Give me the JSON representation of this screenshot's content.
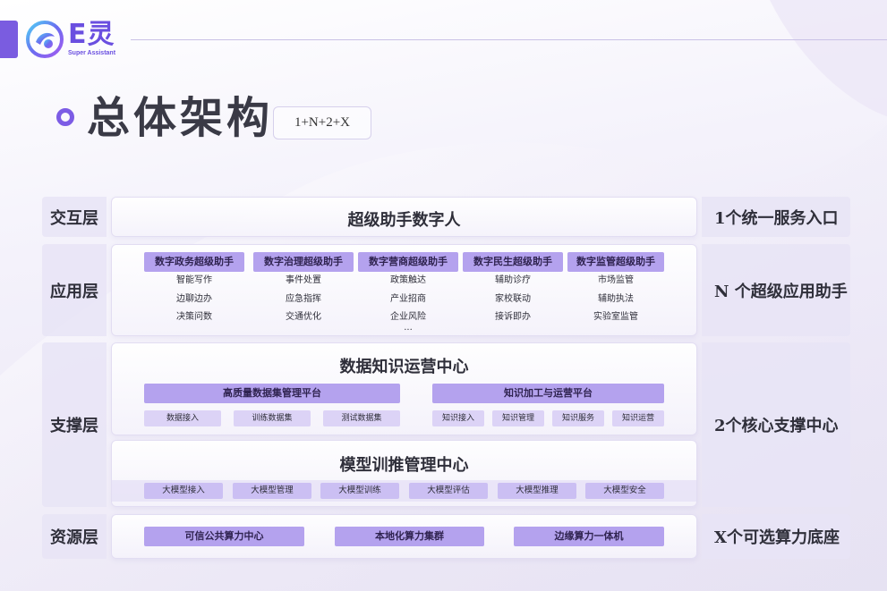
{
  "brand": {
    "name_cn": "E灵",
    "name_en": "Super Assistant"
  },
  "title": "总体架构",
  "formula": "1+N+2+X",
  "layers": {
    "interaction": {
      "label": "交互层",
      "content": "超级助手数字人",
      "summary": "1个统一服务入口"
    },
    "application": {
      "label": "应用层",
      "summary": "N 个超级应用助手",
      "columns": [
        {
          "head": "数字政务超级助手",
          "items": [
            "智能写作",
            "边聊边办",
            "决策问数"
          ]
        },
        {
          "head": "数字治理超级助手",
          "items": [
            "事件处置",
            "应急指挥",
            "交通优化"
          ]
        },
        {
          "head": "数字营商超级助手",
          "items": [
            "政策触达",
            "产业招商",
            "企业风险"
          ],
          "more": "..."
        },
        {
          "head": "数字民生超级助手",
          "items": [
            "辅助诊疗",
            "家校联动",
            "接诉即办"
          ]
        },
        {
          "head": "数字监管超级助手",
          "items": [
            "市场监管",
            "辅助执法",
            "实验室监管"
          ]
        }
      ]
    },
    "support": {
      "label": "支撑层",
      "summary": "2个核心支撑中心",
      "data_center": {
        "title": "数据知识运营中心",
        "platform_a": {
          "name": "高质量数据集管理平台",
          "chips": [
            "数据接入",
            "训练数据集",
            "测试数据集"
          ]
        },
        "platform_b": {
          "name": "知识加工与运营平台",
          "chips": [
            "知识接入",
            "知识管理",
            "知识服务",
            "知识运营"
          ]
        }
      },
      "model_center": {
        "title": "模型训推管理中心",
        "chips": [
          "大模型接入",
          "大模型管理",
          "大模型训练",
          "大模型评估",
          "大模型推理",
          "大模型安全"
        ]
      }
    },
    "resource": {
      "label": "资源层",
      "summary": "X个可选算力底座",
      "chips": [
        "可信公共算力中心",
        "本地化算力集群",
        "边缘算力一体机"
      ]
    }
  },
  "colors": {
    "accent": "#7a5ce0",
    "chip_dark": "#b4a2ee",
    "chip_light": "#dcd3f6",
    "label_bg": "#e8e4f6"
  }
}
